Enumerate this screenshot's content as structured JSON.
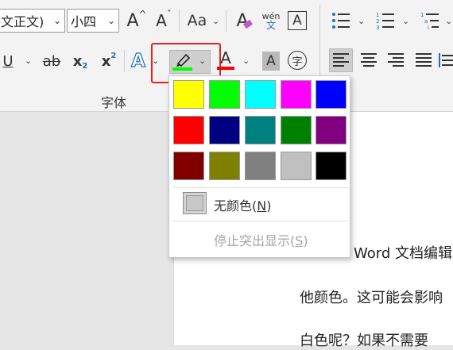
{
  "font_group": {
    "font_name": "文正文)",
    "font_size": "小四",
    "label": "字体"
  },
  "buttons": {
    "grow_font": "A",
    "shrink_font": "A",
    "change_case": "Aa",
    "clear_format_glyph": "A",
    "pinyin_top": "wén",
    "pinyin_bottom": "文",
    "char_border": "A",
    "underline": "U",
    "strikethrough": "ab",
    "subscript": "x",
    "subscript_mark": "2",
    "superscript": "x",
    "superscript_mark": "2",
    "text_effects": "A",
    "font_color": "A",
    "char_shading": "A",
    "enclose_char": "字"
  },
  "highlight_colors": {
    "selected": "#00ff00",
    "font_color_bar": "#ff0000",
    "swatches": [
      [
        "#ffff00",
        "#00ff00",
        "#00ffff",
        "#ff00ff",
        "#0000ff"
      ],
      [
        "#ff0000",
        "#000080",
        "#008080",
        "#008000",
        "#800080"
      ],
      [
        "#800000",
        "#808000",
        "#808080",
        "#c0c0c0",
        "#000000"
      ]
    ]
  },
  "dropdown": {
    "no_color_label": "无颜色(",
    "no_color_key": "N",
    "no_color_close": ")",
    "stop_label": "停止突出显示(",
    "stop_key": "S",
    "stop_close": ")"
  },
  "document": {
    "line1": "Word 文档编辑",
    "line2": "他颜色。这可能会影响",
    "line3": "白色呢？如果不需要"
  }
}
